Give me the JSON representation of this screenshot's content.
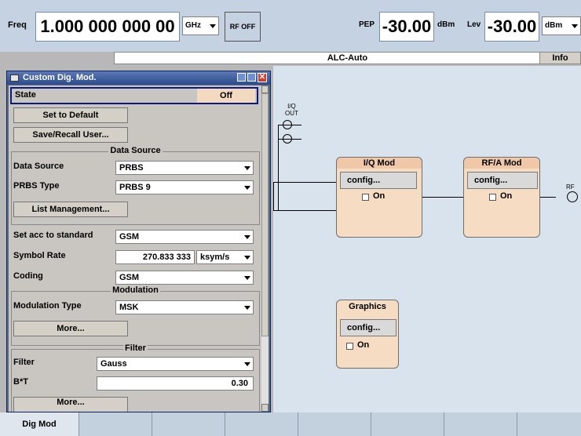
{
  "header": {
    "freq_label": "Freq",
    "freq_value": "1.000 000 000 00",
    "freq_unit": "GHz",
    "rf_off": "RF OFF",
    "pep_label": "PEP",
    "pep_value": "-30.00",
    "pep_unit": "dBm",
    "lev_label": "Lev",
    "lev_value": "-30.00",
    "lev_unit": "dBm"
  },
  "status": {
    "alc": "ALC-Auto",
    "info": "Info"
  },
  "diagram": {
    "iq_out_line1": "I/Q",
    "iq_out_line2": "OUT",
    "rf_label": "RF",
    "blocks": {
      "iq_mod": {
        "title": "I/Q Mod",
        "config": "config...",
        "on": "On"
      },
      "rfa_mod": {
        "title": "RF/A Mod",
        "config": "config...",
        "on": "On"
      },
      "graphics": {
        "title": "Graphics",
        "config": "config...",
        "on": "On"
      }
    }
  },
  "dialog": {
    "title": "Custom Dig. Mod.",
    "state_label": "State",
    "state_value": "Off",
    "set_default": "Set to Default",
    "save_recall": "Save/Recall User...",
    "data_source_group": "Data Source",
    "data_source_label": "Data Source",
    "data_source_value": "PRBS",
    "prbs_type_label": "PRBS Type",
    "prbs_type_value": "PRBS 9",
    "list_management": "List Management...",
    "standard_label": "Set acc to standard",
    "standard_value": "GSM",
    "symbol_rate_label": "Symbol Rate",
    "symbol_rate_value": "270.833 333",
    "symbol_rate_unit": "ksym/s",
    "coding_label": "Coding",
    "coding_value": "GSM",
    "modulation_group": "Modulation",
    "modulation_type_label": "Modulation Type",
    "modulation_type_value": "MSK",
    "more1": "More...",
    "filter_group": "Filter",
    "filter_label": "Filter",
    "filter_value": "Gauss",
    "bt_label": "B*T",
    "bt_value": "0.30",
    "more2": "More..."
  },
  "tabs": [
    "Dig Mod",
    "",
    "",
    "",
    "",
    "",
    "",
    "",
    ""
  ]
}
